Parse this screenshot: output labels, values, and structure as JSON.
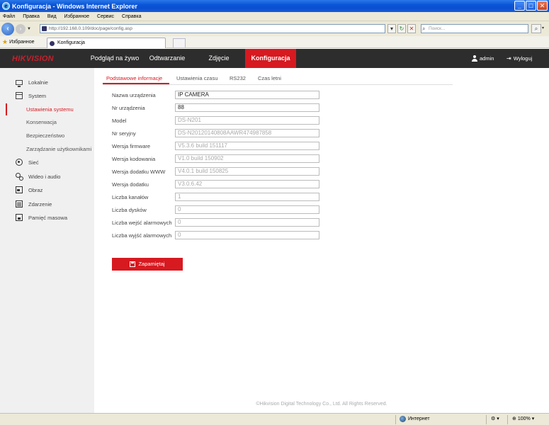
{
  "window": {
    "title": "Konfiguracja - Windows Internet Explorer",
    "min": "_",
    "max": "□",
    "close": "✕"
  },
  "ie_menu": [
    "Файл",
    "Правка",
    "Вид",
    "Избранное",
    "Сервис",
    "Справка"
  ],
  "address": {
    "url": "http://192.168.0.109/doc/page/config.asp",
    "search_placeholder": "Поиск..."
  },
  "favorites": {
    "label": "Избранное",
    "tab_title": "Konfiguracja"
  },
  "header": {
    "logo": "HIKVISION",
    "nav": [
      {
        "label": "Podgląd na żywo"
      },
      {
        "label": "Odtwarzanie"
      },
      {
        "label": "Zdjęcie"
      },
      {
        "label": "Konfiguracja",
        "active": true
      }
    ],
    "user": "admin",
    "logout": "Wyloguj",
    "accent_color": "#d71920"
  },
  "sidebar": {
    "items": [
      {
        "label": "Lokalnie",
        "icon": "monitor-icon"
      },
      {
        "label": "System",
        "icon": "system-icon"
      },
      {
        "label": "Sieć",
        "icon": "network-icon"
      },
      {
        "label": "Wideo i audio",
        "icon": "video-audio-icon"
      },
      {
        "label": "Obraz",
        "icon": "image-icon"
      },
      {
        "label": "Zdarzenie",
        "icon": "event-icon"
      },
      {
        "label": "Pamięć masowa",
        "icon": "storage-icon"
      }
    ],
    "system_sub": [
      {
        "label": "Ustawienia systemu",
        "active": true
      },
      {
        "label": "Konserwacja"
      },
      {
        "label": "Bezpieczeństwo"
      },
      {
        "label": "Zarządzanie użytkownikami"
      }
    ]
  },
  "tabs": [
    {
      "label": "Podstawowe informacje",
      "active": true
    },
    {
      "label": "Ustawienia czasu"
    },
    {
      "label": "RS232"
    },
    {
      "label": "Czas letni"
    }
  ],
  "form": {
    "fields": [
      {
        "label": "Nazwa urządzenia",
        "value": "IP CAMERA",
        "editable": true
      },
      {
        "label": "Nr urządzenia",
        "value": "88",
        "editable": true
      },
      {
        "label": "Model",
        "value": "DS-N201",
        "editable": false
      },
      {
        "label": "Nr seryjny",
        "value": "DS-N20120140808AAWR474987858",
        "editable": false
      },
      {
        "label": "Wersja firmware",
        "value": "V5.3.6 build 151117",
        "editable": false
      },
      {
        "label": "Wersja kodowania",
        "value": "V1.0 build 150902",
        "editable": false
      },
      {
        "label": "Wersja dodatku WWW",
        "value": "V4.0.1 build 150825",
        "editable": false
      },
      {
        "label": "Wersja dodatku",
        "value": "V3.0.6.42",
        "editable": false
      },
      {
        "label": "Liczba kanałów",
        "value": "1",
        "editable": false
      },
      {
        "label": "Liczba dysków",
        "value": "0",
        "editable": false
      },
      {
        "label": "Liczba wejść alarmowych",
        "value": "0",
        "editable": false
      },
      {
        "label": "Liczba wyjść alarmowych",
        "value": "0",
        "editable": false
      }
    ],
    "save_label": "Zapamiętaj"
  },
  "footer": {
    "copyright": "©Hikvision Digital Technology Co., Ltd. All Rights Reserved."
  },
  "statusbar": {
    "zone": "Интернет",
    "zoom": "100%"
  }
}
